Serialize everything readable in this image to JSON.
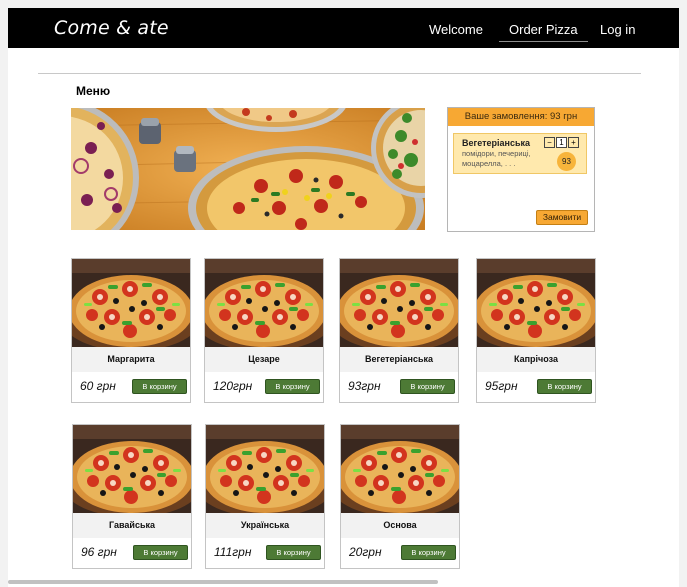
{
  "header": {
    "brand": "Come & ate",
    "nav": [
      "Welcome",
      "Order Pizza",
      "Log in"
    ]
  },
  "menu_title": "Меню",
  "order": {
    "header": "Ваше замовлення: 93 грн",
    "item": {
      "name": "Вегетеріанська",
      "ingredients": "помідори, печериці, моцарелла, . . .",
      "quantity": "1",
      "minus": "−",
      "plus": "+",
      "price": "93"
    },
    "checkout_label": "Замовити"
  },
  "cart_label": "В корзину",
  "pizzas": [
    {
      "name": "Маргарита",
      "price": "60 грн"
    },
    {
      "name": "Цезаре",
      "price": "120грн"
    },
    {
      "name": "Вегетеріанська",
      "price": "93грн"
    },
    {
      "name": "Капрічоза",
      "price": "95грн"
    },
    {
      "name": "Гавайська",
      "price": "96 грн"
    },
    {
      "name": "Українська",
      "price": "111грн"
    },
    {
      "name": "Основа",
      "price": "20грн"
    }
  ],
  "colors": {
    "navbar": "#000000",
    "order_accent": "#f7a833",
    "order_item_bg": "#ffe9ad",
    "cart_button": "#4d7a35"
  }
}
